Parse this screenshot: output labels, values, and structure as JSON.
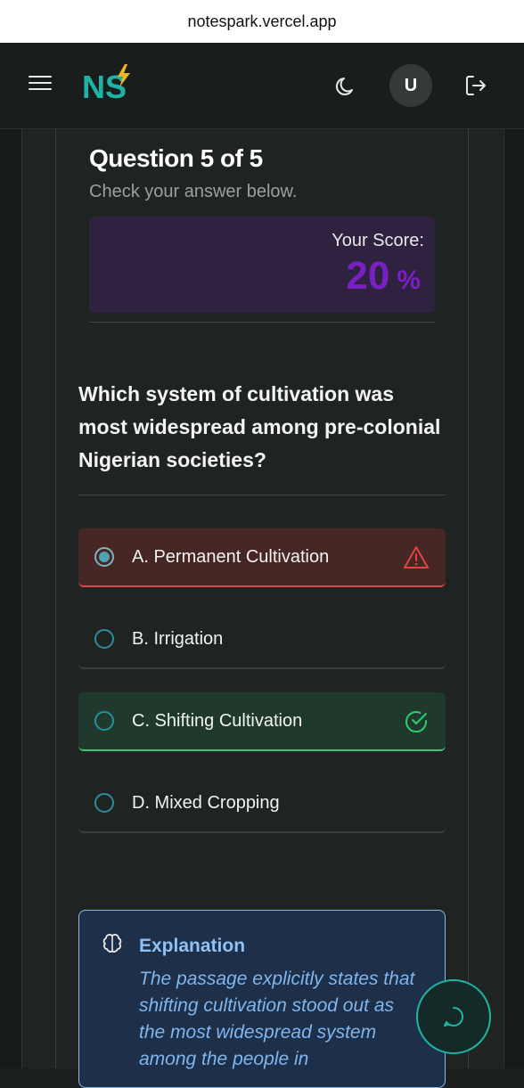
{
  "browser": {
    "url": "notespark.vercel.app"
  },
  "nav": {
    "logo_text": "NS",
    "avatar_initial": "U",
    "menu_icon": "hamburger-icon",
    "theme_icon": "moon-icon",
    "logout_icon": "logout-icon"
  },
  "quiz": {
    "title": "Question 5 of 5",
    "subtitle": "Check your answer below.",
    "score_label": "Your Score:",
    "score_value": "20",
    "score_unit": "%",
    "question": "Which system of cultivation was most widespread among pre-colonial Nigerian societies?",
    "options": [
      {
        "label": "A. Permanent Cultivation",
        "state": "wrong",
        "selected": true,
        "icon": "warning-icon"
      },
      {
        "label": "B. Irrigation",
        "state": "neutral",
        "selected": false
      },
      {
        "label": "C. Shifting Cultivation",
        "state": "correct",
        "selected": false,
        "icon": "check-circle-icon"
      },
      {
        "label": "D. Mixed Cropping",
        "state": "neutral",
        "selected": false
      }
    ]
  },
  "explanation": {
    "title": "Explanation",
    "text": "The passage explicitly states that shifting cultivation stood out as the most widespread system among the people in",
    "icon": "brain-icon"
  },
  "chat": {
    "icon": "chat-bubble-icon"
  },
  "colors": {
    "accent": "#1fb3a6",
    "score": "#7a1fc4",
    "wrong": "#e04444",
    "correct": "#2fcc71",
    "explanation": "#8fc1f5"
  }
}
